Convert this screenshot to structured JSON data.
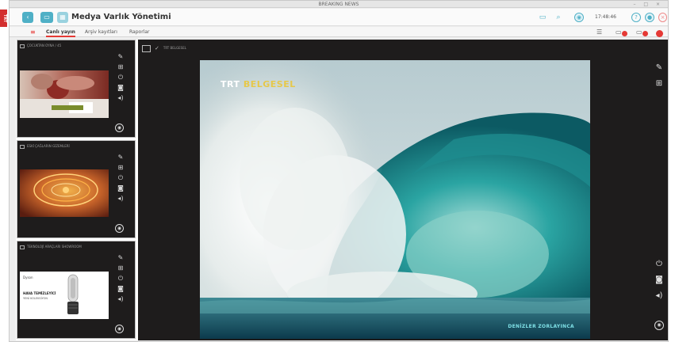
{
  "window": {
    "title": "BREAKING NEWS",
    "controls": "– □ ×"
  },
  "red_tag": "TRT",
  "header": {
    "title": "Medya Varlık Yönetimi",
    "time": "17:48:46"
  },
  "nav": {
    "tabs": [
      {
        "label": "Canlı yayın",
        "active": true
      },
      {
        "label": "Arşiv kayıtları",
        "active": false
      },
      {
        "label": "Raporlar",
        "active": false
      }
    ]
  },
  "sidebar_cards": [
    {
      "label": "ÇOCUKTAN OYNA / 45",
      "thumb": "hands"
    },
    {
      "label": "ESKİ ÇAĞLARIN GİZEMLERİ",
      "thumb": "gold"
    },
    {
      "label": "TEKNOLOJİ ARAÇLARI SHOWROOM",
      "thumb": "product"
    }
  ],
  "product_thumb": {
    "line1": "Dyson",
    "line2": "HAVA TEMİZLEYİCİ",
    "line3": "YENİ KOLEKSİYON"
  },
  "main_video": {
    "label": "TRT BELGESEL",
    "logo_prefix": "TRT",
    "logo_suffix": "BELGESEL",
    "caption": "DENİZLER ZORLAYINCA"
  },
  "icons": {
    "card_side": [
      "edit-icon",
      "expand-icon",
      "power-icon",
      "camera-icon",
      "volume-icon"
    ],
    "card_bottom": "record-icon",
    "main_top": [
      "edit-icon",
      "expand-icon"
    ],
    "main_bottom": [
      "power-icon",
      "camera-icon",
      "volume-icon"
    ]
  },
  "colors": {
    "accent": "#4fb0c6",
    "alert": "#e53935",
    "panel_bg": "#1e1c1c"
  }
}
